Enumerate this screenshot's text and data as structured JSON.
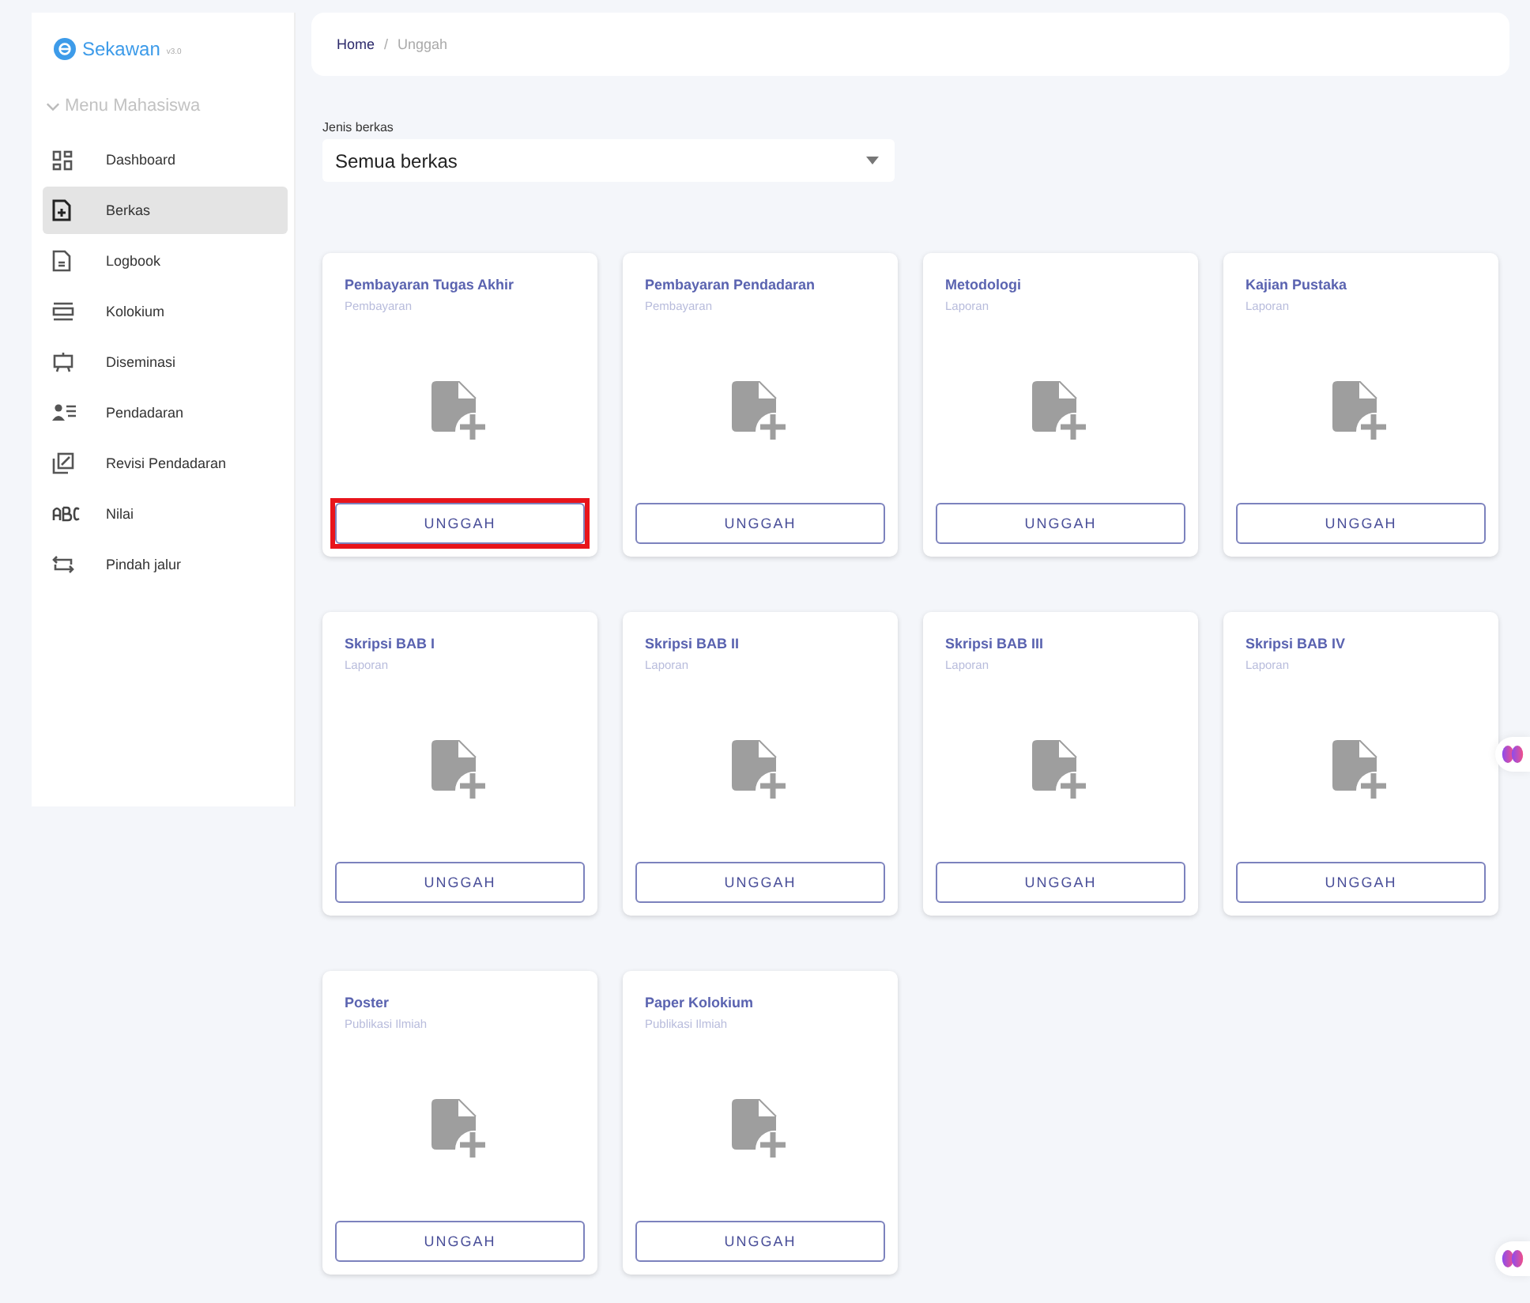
{
  "brand": {
    "name": "Sekawan",
    "version": "v3.0"
  },
  "sidebar": {
    "section": "Menu Mahasiswa",
    "expanded": true,
    "items": [
      {
        "label": "Dashboard",
        "kind": "grid",
        "selected": false
      },
      {
        "label": "Berkas",
        "kind": "fileplus",
        "selected": true
      },
      {
        "label": "Logbook",
        "kind": "doc",
        "selected": false
      },
      {
        "label": "Kolokium",
        "kind": "panel",
        "selected": false
      },
      {
        "label": "Diseminasi",
        "kind": "easel",
        "selected": false
      },
      {
        "label": "Pendadaran",
        "kind": "personlist",
        "selected": false
      },
      {
        "label": "Revisi Pendadaran",
        "kind": "edit",
        "selected": false
      },
      {
        "label": "Nilai",
        "kind": "abc",
        "selected": false
      },
      {
        "label": "Pindah jalur",
        "kind": "swap",
        "selected": false
      }
    ]
  },
  "breadcrumb": {
    "separator": "/",
    "items": [
      {
        "label": "Home",
        "current": false
      },
      {
        "label": "Unggah",
        "current": true
      }
    ]
  },
  "filter": {
    "label": "Jenis berkas",
    "value": "Semua berkas"
  },
  "cards": [
    {
      "title": "Pembayaran Tugas Akhir",
      "category": "Pembayaran",
      "button": "UNGGAH",
      "highlighted": true
    },
    {
      "title": "Pembayaran Pendadaran",
      "category": "Pembayaran",
      "button": "UNGGAH",
      "highlighted": false
    },
    {
      "title": "Metodologi",
      "category": "Laporan",
      "button": "UNGGAH",
      "highlighted": false
    },
    {
      "title": "Kajian Pustaka",
      "category": "Laporan",
      "button": "UNGGAH",
      "highlighted": false
    },
    {
      "title": "Skripsi BAB I",
      "category": "Laporan",
      "button": "UNGGAH",
      "highlighted": false
    },
    {
      "title": "Skripsi BAB II",
      "category": "Laporan",
      "button": "UNGGAH",
      "highlighted": false
    },
    {
      "title": "Skripsi BAB III",
      "category": "Laporan",
      "button": "UNGGAH",
      "highlighted": false
    },
    {
      "title": "Skripsi BAB IV",
      "category": "Laporan",
      "button": "UNGGAH",
      "highlighted": false
    },
    {
      "title": "Poster",
      "category": "Publikasi Ilmiah",
      "button": "UNGGAH",
      "highlighted": false
    },
    {
      "title": "Paper Kolokium",
      "category": "Publikasi Ilmiah",
      "button": "UNGGAH",
      "highlighted": false
    }
  ]
}
